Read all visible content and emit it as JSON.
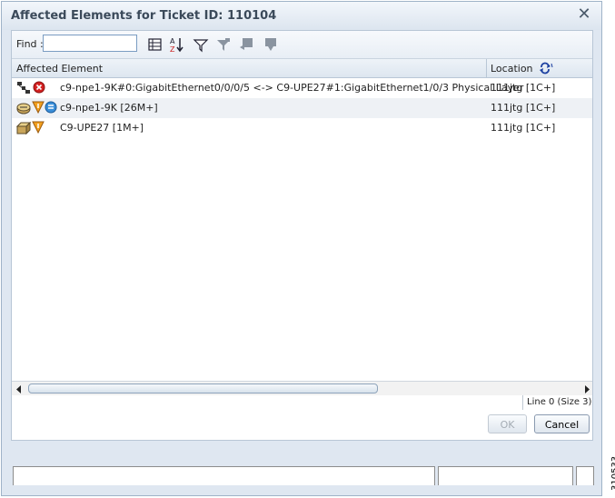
{
  "dialog": {
    "title": "Affected Elements for Ticket ID: 110104",
    "close_icon": "close-icon"
  },
  "toolbar": {
    "find_label": "Find :",
    "find_value": "",
    "icons": [
      "column-chooser-icon",
      "sort-az-icon",
      "filter-icon",
      "advanced-filter-icon",
      "export-icon",
      "print-icon"
    ]
  },
  "table": {
    "columns": [
      "Affected Element",
      "Location"
    ],
    "refresh_icon": "refresh-icon",
    "rows": [
      {
        "element": "c9-npe1-9K#0:GigabitEthernet0/0/0/5 <-> C9-UPE27#1:GigabitEthernet1/0/3 Physical Layer",
        "location": "111jtg [1C+]",
        "icons": [
          "link-icon",
          "critical-alarm-icon"
        ]
      },
      {
        "element": "c9-npe1-9K [26M+]",
        "location": "111jtg [1C+]",
        "icons": [
          "router-icon",
          "warning-icon",
          "info-icon"
        ]
      },
      {
        "element": "C9-UPE27 [1M+]",
        "location": "111jtg [1C+]",
        "icons": [
          "switch-icon",
          "warning-icon"
        ]
      }
    ]
  },
  "status": {
    "text": "Line 0 (Size 3)"
  },
  "buttons": {
    "ok": "OK",
    "cancel": "Cancel"
  },
  "side_label": "310533"
}
